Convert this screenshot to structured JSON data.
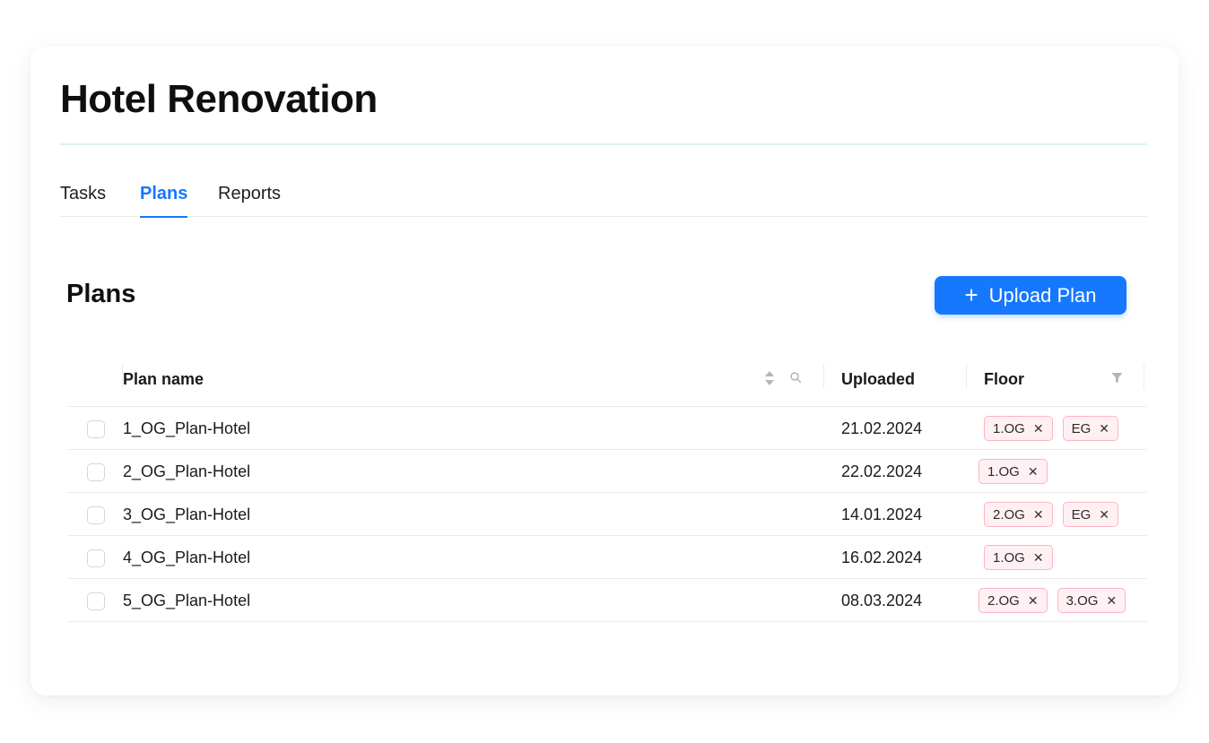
{
  "project": {
    "title": "Hotel Renovation"
  },
  "tabs": [
    {
      "label": "Tasks",
      "active": false
    },
    {
      "label": "Plans",
      "active": true
    },
    {
      "label": "Reports",
      "active": false
    }
  ],
  "section": {
    "title": "Plans",
    "upload_label": "Upload Plan",
    "upload_icon": "plus-icon"
  },
  "table": {
    "columns": {
      "name": "Plan name",
      "uploaded": "Uploaded",
      "floor": "Floor"
    },
    "rows": [
      {
        "name": "1_OG_Plan-Hotel",
        "uploaded": "21.02.2024",
        "floors": [
          "1.OG",
          "EG"
        ]
      },
      {
        "name": "2_OG_Plan-Hotel",
        "uploaded": "22.02.2024",
        "floors": [
          "1.OG"
        ]
      },
      {
        "name": "3_OG_Plan-Hotel",
        "uploaded": "14.01.2024",
        "floors": [
          "2.OG",
          "EG"
        ]
      },
      {
        "name": "4_OG_Plan-Hotel",
        "uploaded": "16.02.2024",
        "floors": [
          "1.OG"
        ]
      },
      {
        "name": "5_OG_Plan-Hotel",
        "uploaded": "08.03.2024",
        "floors": [
          "2.OG",
          "3.OG"
        ]
      }
    ]
  },
  "colors": {
    "accent": "#1677ff",
    "tag_background": "#fff0f3",
    "tag_border": "#ffb3c2",
    "title_rule": "#d6f5ea"
  }
}
